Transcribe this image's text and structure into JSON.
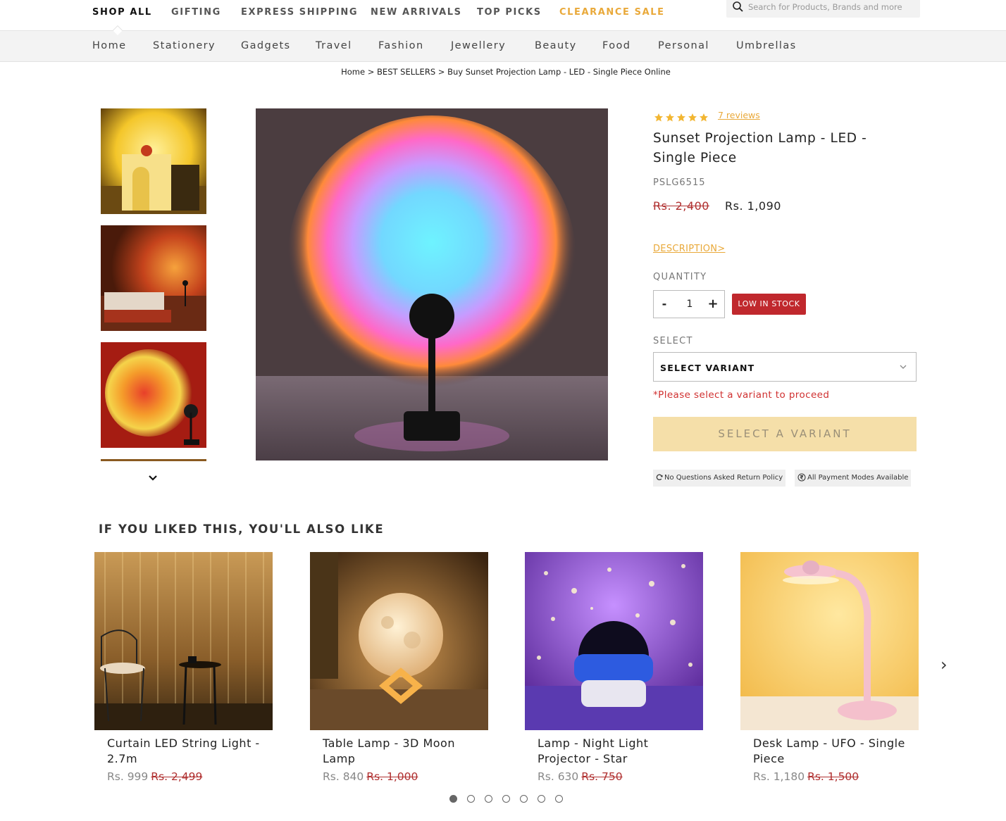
{
  "topnav": {
    "items": [
      "SHOP ALL",
      "GIFTING",
      "EXPRESS SHIPPING",
      "NEW ARRIVALS",
      "TOP PICKS",
      "CLEARANCE SALE"
    ],
    "search_placeholder": "Search for Products, Brands and more",
    "sale_color": "#e9a93a"
  },
  "categories": [
    "Home",
    "Stationery",
    "Gadgets",
    "Travel",
    "Fashion",
    "Jewellery",
    "Beauty",
    "Food",
    "Personal",
    "Umbrellas"
  ],
  "breadcrumb": {
    "home": "Home",
    "sep1": " > ",
    "section": "BEST SELLERS",
    "sep2": " > ",
    "current": "Buy Sunset Projection Lamp - LED - Single Piece Online"
  },
  "product": {
    "rating": 5,
    "reviews_label": "7 reviews",
    "title": "Sunset Projection Lamp - LED - Single Piece",
    "sku": "PSLG6515",
    "old_price": "Rs. 2,400",
    "new_price": "Rs. 1,090",
    "description_link": "DESCRIPTION>",
    "quantity_label": "QUANTITY",
    "quantity_minus": "-",
    "quantity_value": "1",
    "quantity_plus": "+",
    "stock_badge": "LOW IN STOCK",
    "select_label": "SELECT",
    "select_value": "SELECT VARIANT",
    "warning": "*Please select a variant to proceed",
    "cta": "SELECT A VARIANT",
    "badge_returns": "No Questions Asked Return Policy",
    "badge_payment": "All Payment Modes Available"
  },
  "recommendations": {
    "title": "IF YOU LIKED THIS, YOU'LL ALSO LIKE",
    "items": [
      {
        "name": "Curtain LED String Light - 2.7m",
        "price": "Rs. 999",
        "old_price": "Rs. 2,499"
      },
      {
        "name": "Table Lamp - 3D Moon Lamp",
        "price": "Rs. 840",
        "old_price": "Rs. 1,000"
      },
      {
        "name": "Lamp - Night Light Projector - Star",
        "price": "Rs. 630",
        "old_price": "Rs. 750"
      },
      {
        "name": "Desk Lamp - UFO - Single Piece",
        "price": "Rs. 1,180",
        "old_price": "Rs. 1,500"
      }
    ],
    "next_arrow": "›",
    "page_count": 7,
    "active_page": 1
  },
  "icons": {
    "search": "search-icon",
    "star": "star-icon",
    "chevron_down": "chevron-down-icon",
    "refresh": "refresh-icon",
    "rupee": "rupee-icon",
    "next": "chevron-right-icon"
  }
}
